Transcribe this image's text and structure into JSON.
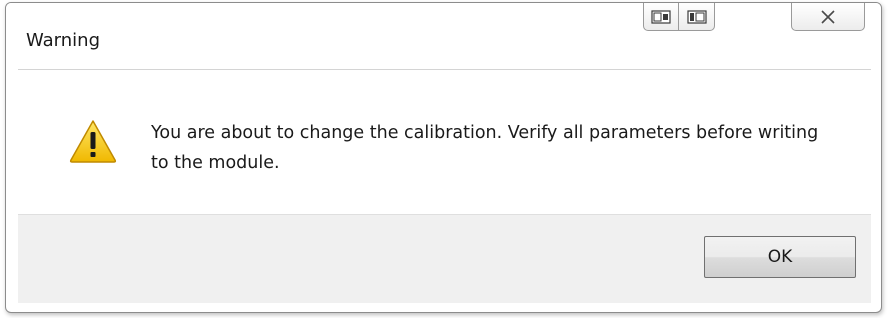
{
  "window": {
    "title": "Warning"
  },
  "caption_buttons": [
    {
      "name": "restore-left-icon"
    },
    {
      "name": "restore-right-icon"
    },
    {
      "name": "close-icon",
      "glyph": "✕"
    }
  ],
  "dialog": {
    "icon": "warning-icon",
    "message": "You are about to change the calibration. Verify all parameters before writing to the module."
  },
  "buttons": {
    "ok_label": "OK"
  },
  "colors": {
    "footer_bg": "#f0f0f0",
    "warning_yellow": "#f5c400",
    "border": "#8c8c8c"
  }
}
